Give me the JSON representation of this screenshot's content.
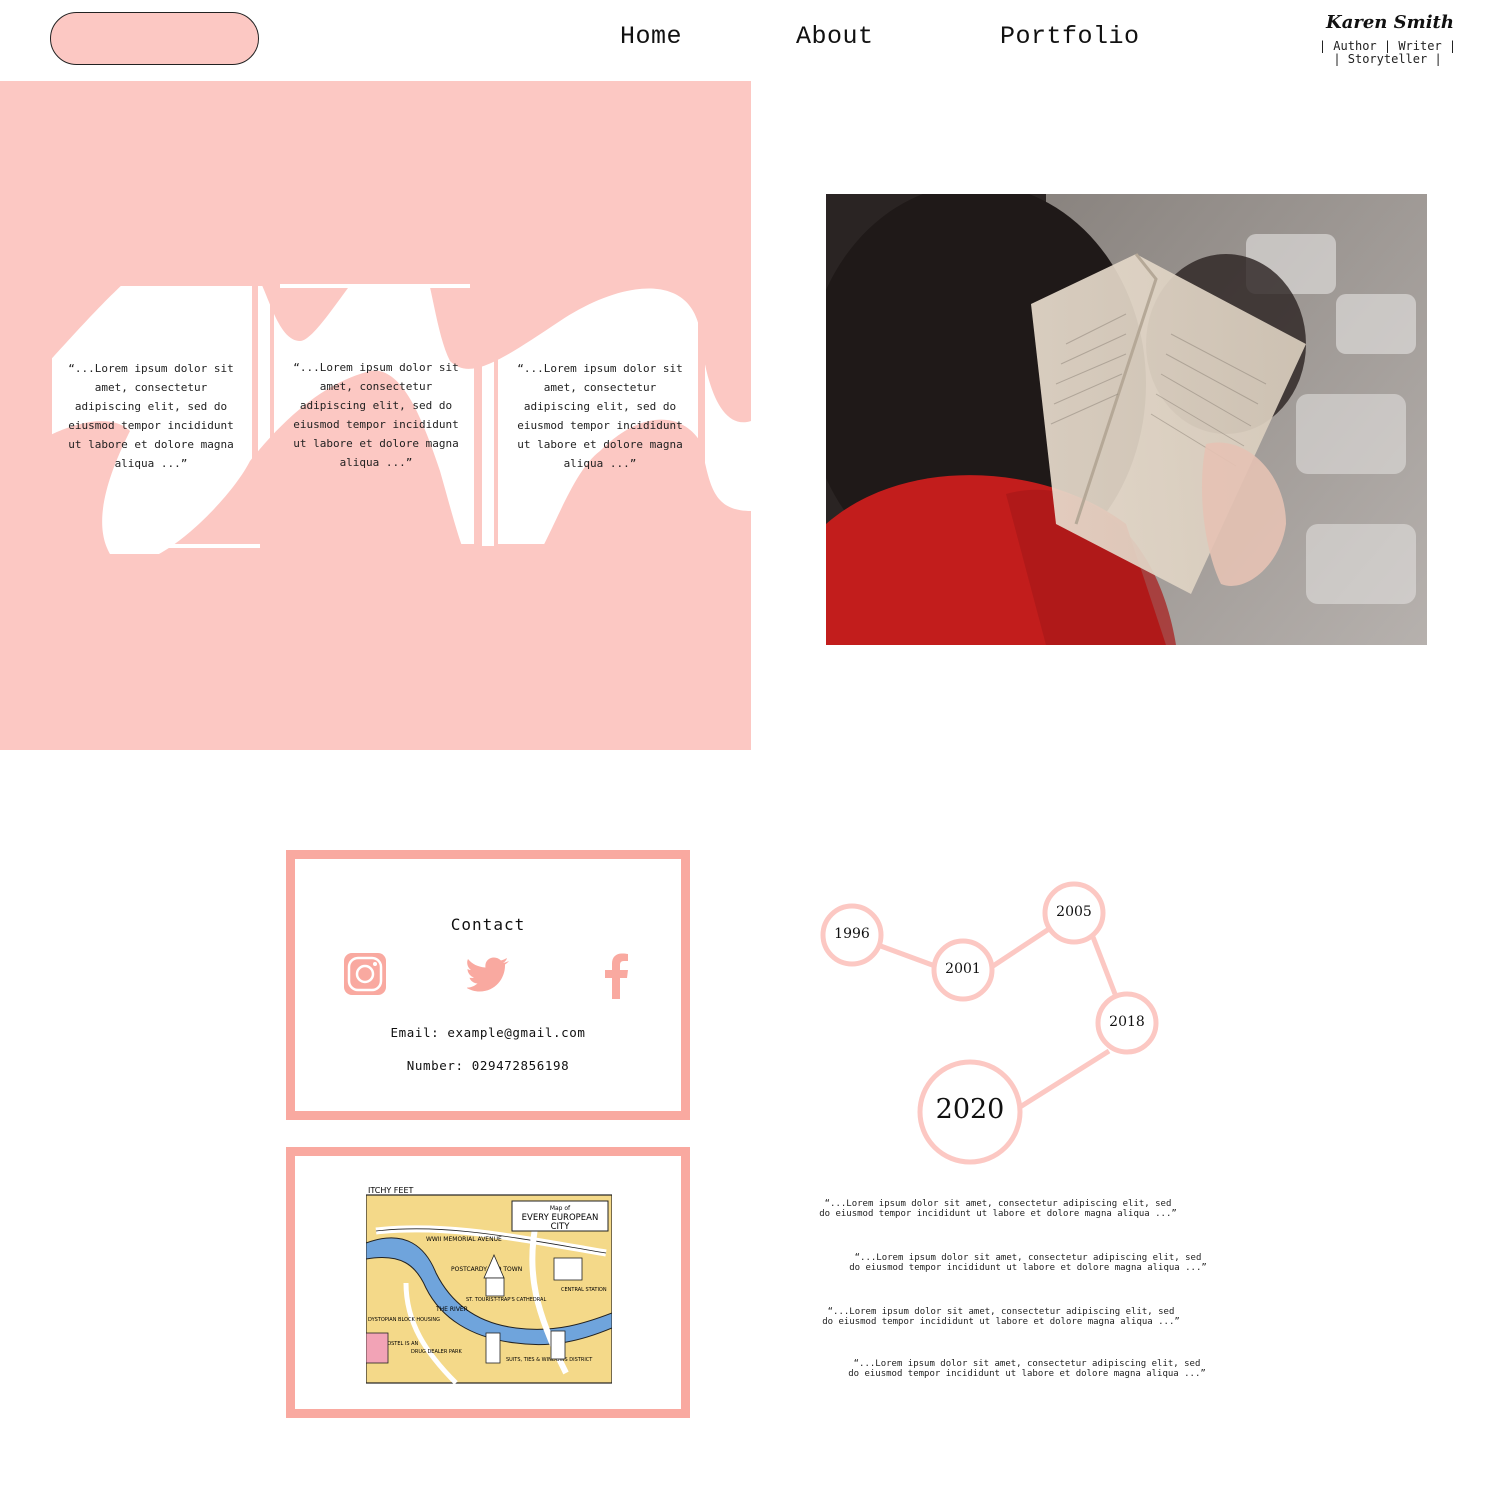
{
  "header": {
    "nav": [
      "Home",
      "About",
      "Portfolio"
    ],
    "brand_name": "Karen Smith",
    "brand_tagline_1": "| Author | Writer |",
    "brand_tagline_2": "| Storyteller |"
  },
  "colors": {
    "accent": "#fcc8c3",
    "accent_strong": "#f9a9a0"
  },
  "hero": {
    "quotes": [
      "“...Lorem ipsum dolor sit amet, consectetur adipiscing elit, sed do eiusmod tempor incididunt ut labore et dolore magna aliqua ...”",
      "“...Lorem ipsum dolor sit amet, consectetur adipiscing elit, sed do eiusmod tempor incididunt ut labore et dolore magna aliqua ...”",
      "“...Lorem ipsum dolor sit amet, consectetur adipiscing elit, sed do eiusmod tempor incididunt ut labore et dolore magna aliqua ...”"
    ]
  },
  "contact": {
    "title": "Contact",
    "email": "Email: example@gmail.com",
    "number": "Number: 029472856198",
    "icons": [
      "instagram-icon",
      "twitter-icon",
      "facebook-icon"
    ]
  },
  "map": {
    "header_left": "ITCHY FEET",
    "title_small": "Map of",
    "title_big_1": "EVERY EUROPEAN",
    "title_big_2": "CITY",
    "labels": [
      "WWII MEMORIAL AVENUE",
      "POSTCARDY OLD TOWN",
      "THE RIVER",
      "ST. TOURIST-TRAP'S CATHEDRAL",
      "SUITS, TIES & WINDOWS DISTRICT",
      "YOUR HOSTEL IS AN",
      "DRUG DEALER PARK",
      "DYSTOPIAN BLOCK HOUSING",
      "CENTRAL STATION"
    ]
  },
  "timeline": {
    "years": [
      "1996",
      "2001",
      "2005",
      "2018",
      "2020"
    ],
    "entries": [
      "“...Lorem ipsum dolor sit amet, consectetur adipiscing elit, sed do eiusmod tempor incididunt ut labore et dolore magna aliqua ...”",
      "“...Lorem ipsum dolor sit amet, consectetur adipiscing elit, sed do eiusmod tempor incididunt ut labore et dolore magna aliqua ...”",
      "“...Lorem ipsum dolor sit amet, consectetur adipiscing elit, sed do eiusmod tempor incididunt ut labore et dolore magna aliqua ...”",
      "“...Lorem ipsum dolor sit amet, consectetur adipiscing elit, sed do eiusmod tempor incididunt ut labore et dolore magna aliqua ...”"
    ]
  }
}
